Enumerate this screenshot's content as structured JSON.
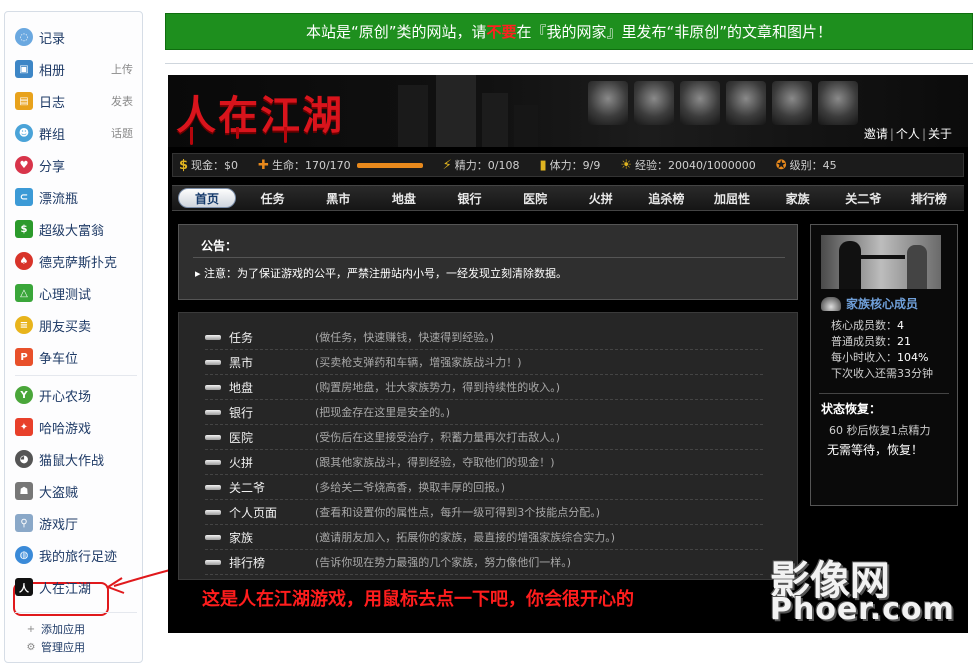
{
  "sidebar": {
    "items": [
      {
        "label": "记录",
        "aux": "",
        "icon": "chat-icon",
        "color": "#6aa8e0"
      },
      {
        "label": "相册",
        "aux": "上传",
        "icon": "photo-icon",
        "color": "#3d86c6"
      },
      {
        "label": "日志",
        "aux": "发表",
        "icon": "diary-icon",
        "color": "#e8a21c"
      },
      {
        "label": "群组",
        "aux": "话题",
        "icon": "group-icon",
        "color": "#4aa3d8"
      },
      {
        "label": "分享",
        "aux": "",
        "icon": "heart-icon",
        "color": "#d8344a"
      },
      {
        "label": "漂流瓶",
        "aux": "",
        "icon": "bottle-icon",
        "color": "#3c9ad6"
      },
      {
        "label": "超级大富翁",
        "aux": "",
        "icon": "money-icon",
        "color": "#2b9a2b"
      },
      {
        "label": "德克萨斯扑克",
        "aux": "",
        "icon": "poker-icon",
        "color": "#d8342a"
      },
      {
        "label": "心理测试",
        "aux": "",
        "icon": "flask-icon",
        "color": "#3aa63a"
      },
      {
        "label": "朋友买卖",
        "aux": "",
        "icon": "coins-icon",
        "color": "#e8b41c"
      },
      {
        "label": "争车位",
        "aux": "",
        "icon": "parking-icon",
        "color": "#e8502a"
      },
      {
        "label": "开心农场",
        "aux": "",
        "icon": "sprout-icon",
        "color": "#4aa63a"
      },
      {
        "label": "哈哈游戏",
        "aux": "",
        "icon": "game-icon",
        "color": "#e8402a"
      },
      {
        "label": "猫鼠大作战",
        "aux": "",
        "icon": "cat-icon",
        "color": "#555555"
      },
      {
        "label": "大盗贼",
        "aux": "",
        "icon": "thief-icon",
        "color": "#777777"
      },
      {
        "label": "游戏厅",
        "aux": "",
        "icon": "joystick-icon",
        "color": "#8aa8c8"
      },
      {
        "label": "我的旅行足迹",
        "aux": "",
        "icon": "globe-icon",
        "color": "#3a8ad8"
      },
      {
        "label": "人在江湖",
        "aux": "",
        "icon": "jianghu-icon",
        "color": "#111111"
      }
    ],
    "add_app": "添加应用",
    "manage_app": "管理应用"
  },
  "notice": {
    "part1": "本站是“原创”类的网站，请",
    "warn": "不要",
    "part2": "在『我的网家』里发布“非原创”的文章和图片！"
  },
  "game": {
    "logo": "人在江湖",
    "top_links": [
      "邀请",
      "个人",
      "关于"
    ],
    "stats": {
      "cash": "现金：$0",
      "life": "生命：170/170",
      "energy": "精力：0/108",
      "stamina": "体力：9/9",
      "exp": "经验：20040/1000000",
      "level": "级别：45"
    },
    "nav": [
      "首页",
      "任务",
      "黑市",
      "地盘",
      "银行",
      "医院",
      "火拼",
      "追杀榜",
      "加屈性",
      "家族",
      "关二爷",
      "排行榜"
    ],
    "announcement": {
      "title": "公告：",
      "text": "注意：为了保证游戏的公平，严禁注册站内小号，一经发现立刻清除数据。"
    },
    "menu": [
      {
        "name": "任务",
        "desc": "(做任务，快速赚钱，快速得到经验。)"
      },
      {
        "name": "黑市",
        "desc": "(买卖枪支弹药和车辆，增强家族战斗力！)"
      },
      {
        "name": "地盘",
        "desc": "(购置房地盘，壮大家族势力，得到持续性的收入。)"
      },
      {
        "name": "银行",
        "desc": "(把现金存在这里是安全的。)"
      },
      {
        "name": "医院",
        "desc": "(受伤后在这里接受治疗，积蓄力量再次打击敌人。)"
      },
      {
        "name": "火拼",
        "desc": "(跟其他家族战斗，得到经验，夺取他们的现金！)"
      },
      {
        "name": "关二爷",
        "desc": "(多给关二爷烧高香，换取丰厚的回报。)"
      },
      {
        "name": "个人页面",
        "desc": "(查看和设置你的属性点，每升一级可得到3个技能点分配。)"
      },
      {
        "name": "家族",
        "desc": "(邀请朋友加入，拓展你的家族，最直接的增强家族综合实力。)"
      },
      {
        "name": "排行榜",
        "desc": "(告诉你现在势力最强的几个家族，努力像他们一样。)"
      }
    ],
    "family": {
      "title": "家族核心成员",
      "rows": [
        {
          "label": "核心成员数：",
          "value": "4"
        },
        {
          "label": "普通成员数：",
          "value": "21"
        },
        {
          "label": "每小时收入：",
          "value": "104%"
        },
        {
          "label": "下次收入还需33分钟",
          "value": ""
        }
      ]
    },
    "status": {
      "title": "状态恢复：",
      "recover": "60 秒后恢复1点精力",
      "wait": "无需等待，恢复！"
    }
  },
  "caption": "这是人在江湖游戏，用鼠标去点一下吧，你会很开心的",
  "watermark": {
    "top": "影像网",
    "bottom": "Phoer.com"
  }
}
